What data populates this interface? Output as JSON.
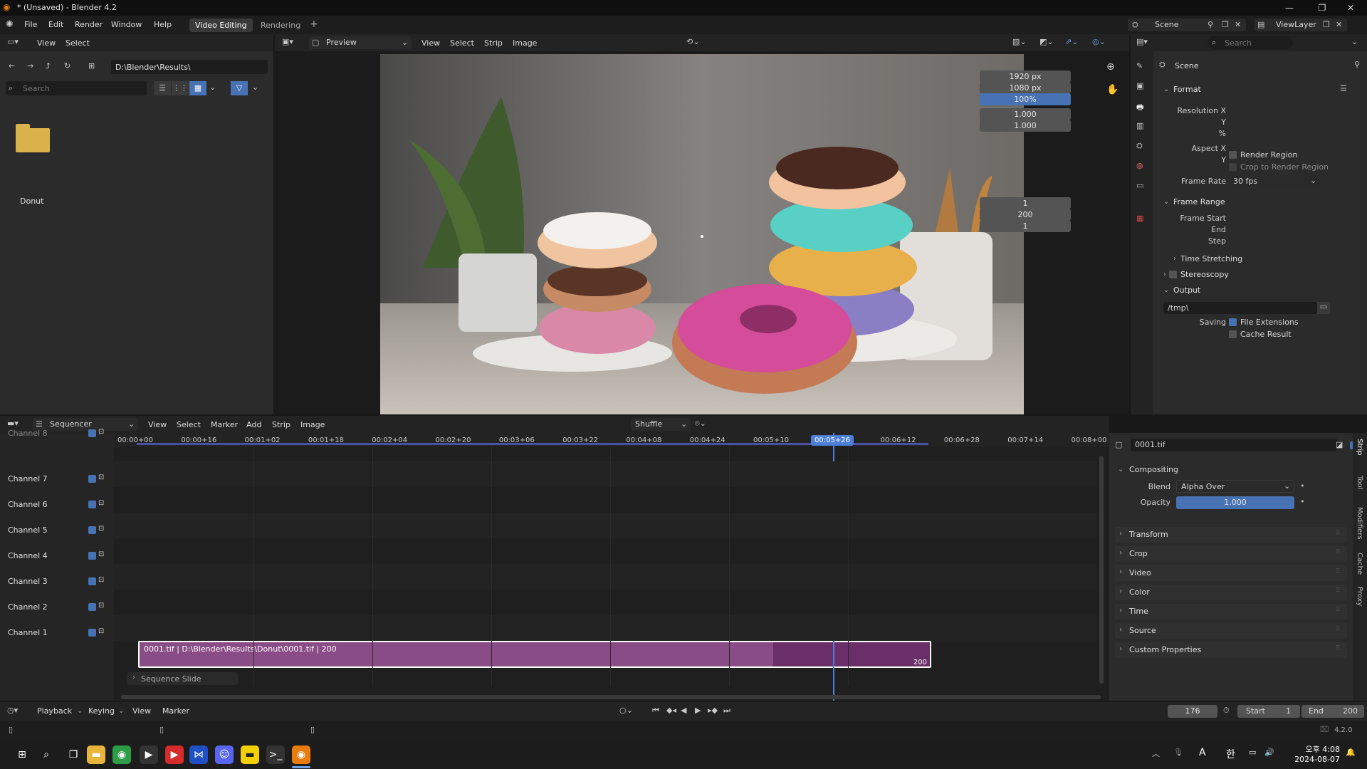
{
  "window": {
    "title": "* (Unsaved) - Blender 4.2",
    "controls": [
      "—",
      "❐",
      "✕"
    ]
  },
  "topbar": {
    "menus": [
      "File",
      "Edit",
      "Render",
      "Window",
      "Help"
    ],
    "workspaces": [
      "Video Editing",
      "Rendering"
    ],
    "add": "+",
    "scene": "Scene",
    "view_layer": "ViewLayer"
  },
  "file_browser": {
    "menus": [
      "View",
      "Select"
    ],
    "path": "D:\\Blender\\Results\\",
    "search_placeholder": "Search",
    "items": [
      {
        "name": "Donut",
        "type": "folder"
      }
    ]
  },
  "preview": {
    "editor": "Preview",
    "menus": [
      "View",
      "Select",
      "Strip",
      "Image"
    ]
  },
  "properties": {
    "search_placeholder": "Search",
    "scene_label": "Scene",
    "format": {
      "title": "Format",
      "res_x_label": "Resolution X",
      "res_x": "1920 px",
      "y_label": "Y",
      "res_y": "1080 px",
      "pct_label": "%",
      "pct": "100%",
      "aspect_x_label": "Aspect X",
      "aspect_x": "1.000",
      "aspect_y_label": "Y",
      "aspect_y": "1.000",
      "render_region": "Render Region",
      "crop_region": "Crop to Render Region",
      "frame_rate_label": "Frame Rate",
      "frame_rate": "30 fps"
    },
    "frame_range": {
      "title": "Frame Range",
      "start_label": "Frame Start",
      "start": "1",
      "end_label": "End",
      "end": "200",
      "step_label": "Step",
      "step": "1",
      "time_stretching": "Time Stretching"
    },
    "stereoscopy": "Stereoscopy",
    "output": {
      "title": "Output",
      "path": "/tmp\\",
      "saving_label": "Saving",
      "file_extensions": "File Extensions",
      "cache_result": "Cache Result"
    }
  },
  "sequencer": {
    "editor": "Sequencer",
    "menus": [
      "View",
      "Select",
      "Marker",
      "Add",
      "Strip",
      "Image"
    ],
    "shuffle": "Shuffle",
    "timecodes": [
      "00:00+00",
      "00:00+16",
      "00:01+02",
      "00:01+18",
      "00:02+04",
      "00:02+20",
      "00:03+06",
      "00:03+22",
      "00:04+08",
      "00:04+24",
      "00:05+10",
      "00:05+26",
      "00:06+12",
      "00:06+28",
      "00:07+14",
      "00:08+00"
    ],
    "current": "00:05+26",
    "channels": [
      "Channel 8",
      "Channel 7",
      "Channel 6",
      "Channel 5",
      "Channel 4",
      "Channel 3",
      "Channel 2",
      "Channel 1"
    ],
    "strip": {
      "label": "0001.tif | D:\\Blender\\Results\\Donut\\0001.tif | 200",
      "end": "200"
    },
    "sequence_slide": "Sequence Slide"
  },
  "strip_panel": {
    "name": "0001.tif",
    "compositing": "Compositing",
    "blend_label": "Blend",
    "blend": "Alpha Over",
    "opacity_label": "Opacity",
    "opacity": "1.000",
    "sections": [
      "Transform",
      "Crop",
      "Video",
      "Color",
      "Time",
      "Source",
      "Custom Properties"
    ],
    "side_tabs": [
      "Strip",
      "Tool",
      "Modifiers",
      "Cache",
      "Proxy"
    ]
  },
  "timeline": {
    "menus": [
      "Playback",
      "Keying",
      "View",
      "Marker"
    ],
    "frame": "176",
    "start_label": "Start",
    "start": "1",
    "end_label": "End",
    "end": "200"
  },
  "status": {
    "version": "4.2.0"
  },
  "taskbar": {
    "icons": [
      "windows-icon",
      "search-icon",
      "taskview-icon",
      "explorer-icon",
      "chrome-icon",
      "media-icon",
      "youtube-music-icon",
      "editor-icon",
      "discord-icon",
      "kakaotalk-icon",
      "terminal-icon",
      "blender-icon"
    ],
    "time": "오후 4:08",
    "date": "2024-08-07",
    "ime": "A",
    "ime2": "한"
  }
}
